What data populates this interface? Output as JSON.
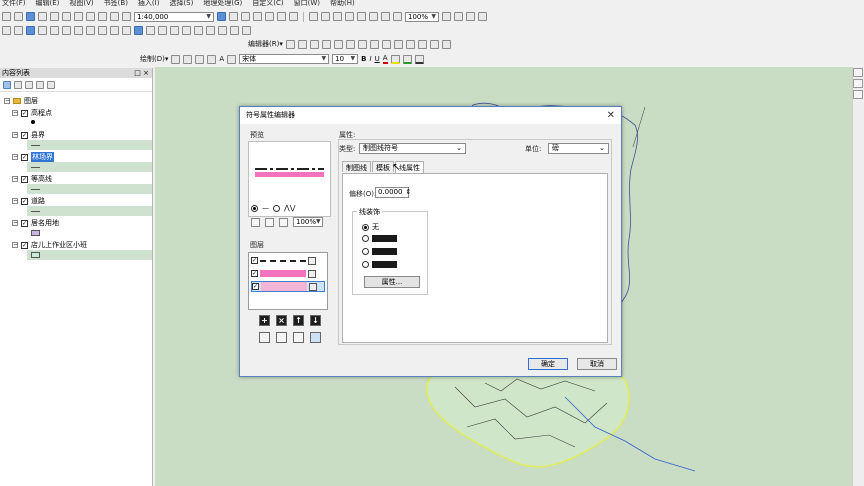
{
  "menu": [
    "文件(F)",
    "编辑(E)",
    "视图(V)",
    "书签(B)",
    "插入(I)",
    "选择(S)",
    "地理处理(G)",
    "自定义(C)",
    "窗口(W)",
    "帮助(H)"
  ],
  "toolbar": {
    "scale": "1:40,000",
    "zoom": "100%",
    "editor_label": "编辑器(R)▾",
    "drawing_label": "绘制(D)▾",
    "font_name": "宋体",
    "font_size": "10",
    "bold": "B",
    "italic": "I",
    "underline": "U",
    "font_color": "A"
  },
  "toc": {
    "title": "内容列表",
    "root": "图层",
    "layers": [
      {
        "name": "高程点",
        "checked": true,
        "selected": false
      },
      {
        "name": "县界",
        "checked": true,
        "selected": false
      },
      {
        "name": "林场界",
        "checked": true,
        "selected": true
      },
      {
        "name": "等高线",
        "checked": true,
        "selected": false
      },
      {
        "name": "道路",
        "checked": true,
        "selected": false
      },
      {
        "name": "居名用地",
        "checked": true,
        "selected": false
      },
      {
        "name": "店儿上作业区小班",
        "checked": true,
        "selected": false
      }
    ]
  },
  "dialog": {
    "title": "符号属性编辑器",
    "preview_label": "预览",
    "zoom": "100%",
    "layers_label": "图层",
    "properties_label": "属性:",
    "type_label": "类型:",
    "type_value": "制图线符号",
    "unit_label": "单位:",
    "unit_value": "磅",
    "tabs": [
      "制图线",
      "模板",
      "线属性"
    ],
    "offset_label": "偏移(O):",
    "offset_value": "0.0000",
    "decoration_label": "线装饰",
    "none_label": "无",
    "props_button": "属性...",
    "ok": "确定",
    "cancel": "取消"
  },
  "colors": {
    "map_bg": "#c9dcc4",
    "pink_line": "#f272c0",
    "selection": "#3176d4"
  }
}
